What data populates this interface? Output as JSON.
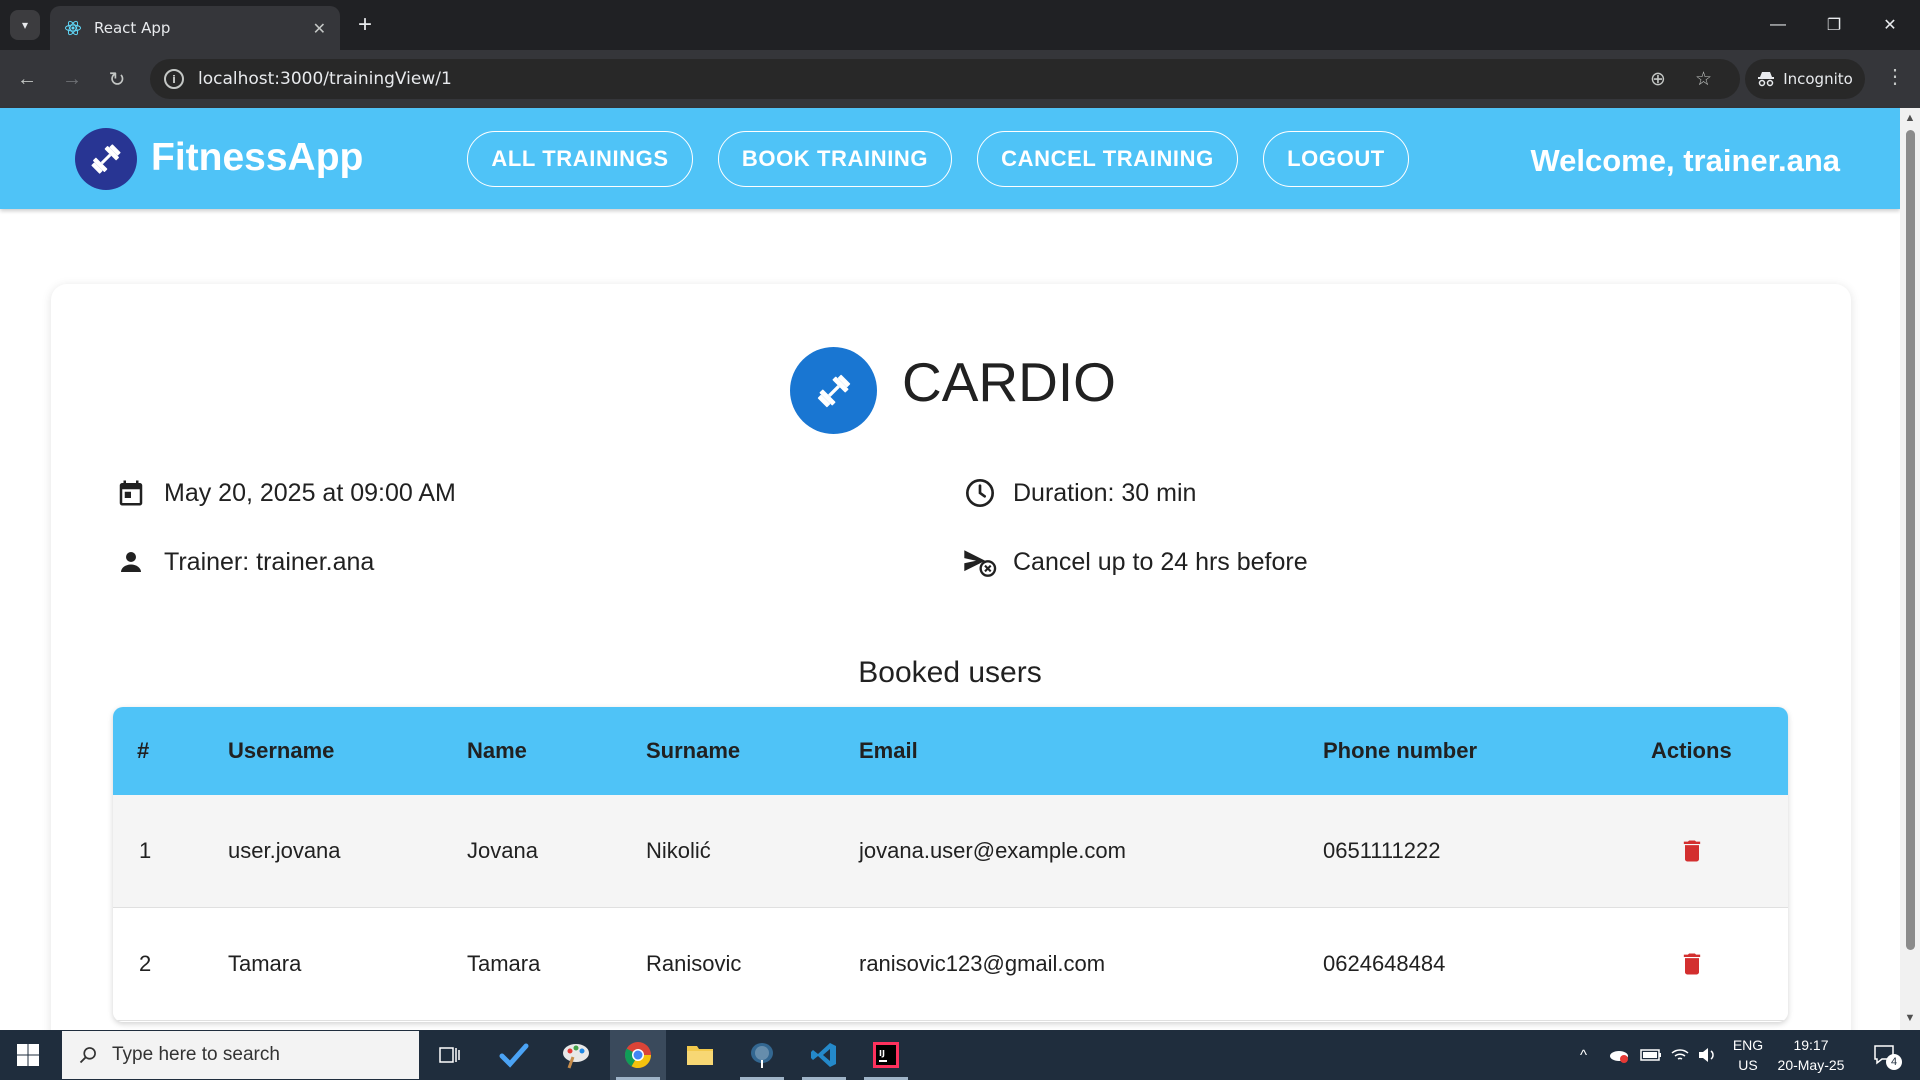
{
  "browser": {
    "tab_title": "React App",
    "url": "localhost:3000/trainingView/1",
    "incognito_label": "Incognito"
  },
  "app": {
    "brand": "FitnessApp",
    "nav": [
      {
        "label": "ALL TRAININGS"
      },
      {
        "label": "BOOK TRAINING"
      },
      {
        "label": "CANCEL TRAINING"
      },
      {
        "label": "LOGOUT"
      }
    ],
    "welcome": "Welcome, trainer.ana"
  },
  "training": {
    "name": "CARDIO",
    "datetime": "May 20, 2025 at 09:00 AM",
    "duration": "Duration: 30 min",
    "trainer": "Trainer: trainer.ana",
    "cancel_policy": "Cancel up to 24 hrs before"
  },
  "booked": {
    "title": "Booked users",
    "columns": [
      "#",
      "Username",
      "Name",
      "Surname",
      "Email",
      "Phone number",
      "Actions"
    ],
    "rows": [
      {
        "num": "1",
        "username": "user.jovana",
        "name": "Jovana",
        "surname": "Nikolić",
        "email": "jovana.user@example.com",
        "phone": "0651111222"
      },
      {
        "num": "2",
        "username": "Tamara",
        "name": "Tamara",
        "surname": "Ranisovic",
        "email": "ranisovic123@gmail.com",
        "phone": "0624648484"
      }
    ]
  },
  "taskbar": {
    "search_placeholder": "Type here to search",
    "lang_top": "ENG",
    "lang_bottom": "US",
    "time": "19:17",
    "date": "20-May-25",
    "notification_count": "4"
  },
  "colors": {
    "header_bg": "#4fc3f7",
    "logo_bg": "#283593",
    "training_icon_bg": "#1976d2",
    "delete_icon": "#d32f2f"
  }
}
